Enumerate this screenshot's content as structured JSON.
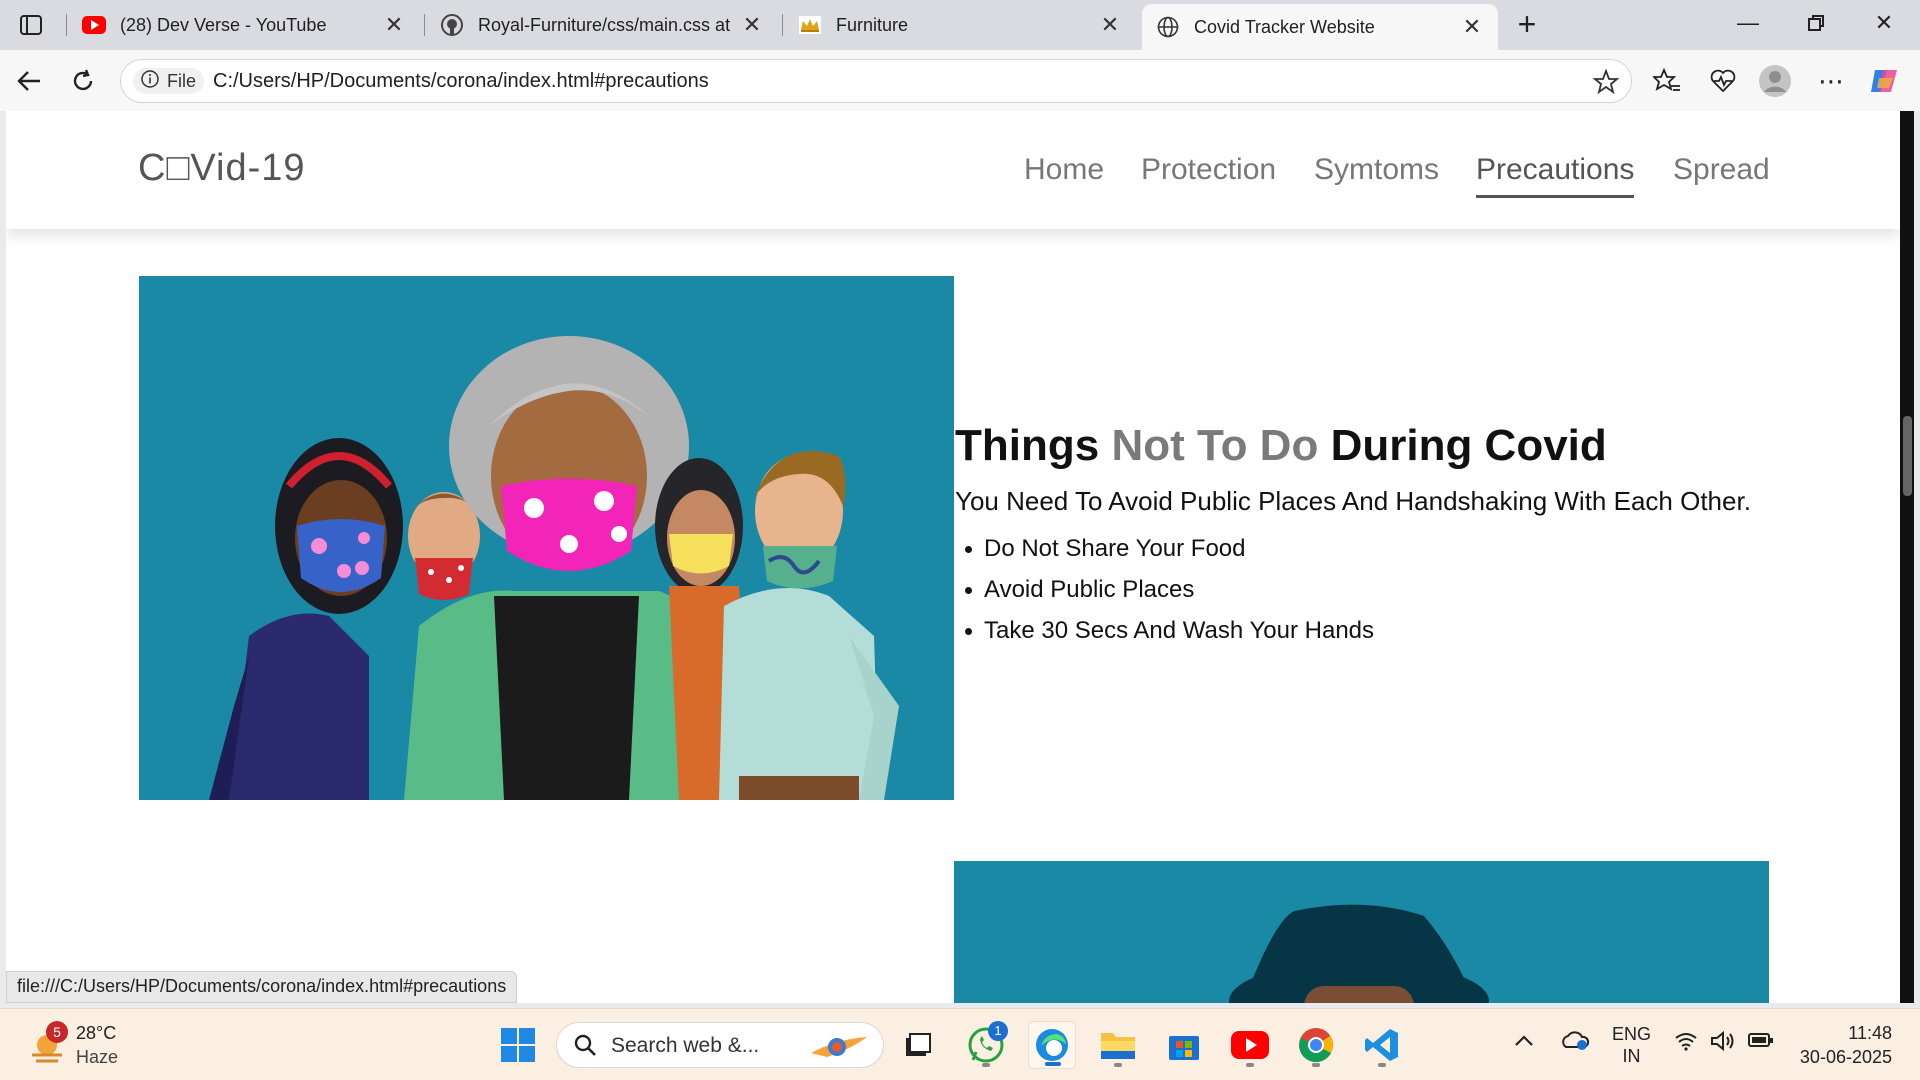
{
  "browser": {
    "tabs": [
      {
        "title": "(28) Dev Verse - YouTube",
        "icon": "youtube-icon"
      },
      {
        "title": "Royal-Furniture/css/main.css at m",
        "icon": "github-icon"
      },
      {
        "title": "Furniture",
        "icon": "crown-icon"
      },
      {
        "title": "Covid Tracker Website",
        "icon": "globe-icon",
        "active": true
      }
    ],
    "address": {
      "scheme_label": "File",
      "url": "C:/Users/HP/Documents/corona/index.html#precautions"
    },
    "status_url": "file:///C:/Users/HP/Documents/corona/index.html#precautions"
  },
  "site": {
    "logo": "C□Vid-19",
    "nav": [
      "Home",
      "Protection",
      "Symtoms",
      "Precautions",
      "Spread"
    ],
    "active_nav": "Precautions",
    "section": {
      "heading_start": "Things ",
      "heading_highlight": "Not To Do",
      "heading_end": " During Covid",
      "subtext": "You Need To Avoid Public Places And Handshaking With Each Other.",
      "bullets": [
        "Do Not Share Your Food",
        "Avoid Public Places",
        "Take 30 Secs And Wash Your Hands"
      ]
    },
    "colors": {
      "image_bg": "#1a89a6",
      "highlight": "#7a7a7a"
    }
  },
  "taskbar": {
    "weather": {
      "temp": "28°C",
      "condition": "Haze",
      "badge": "5"
    },
    "search_placeholder": "Search web &...",
    "whatsapp_badge": "1",
    "language": {
      "line1": "ENG",
      "line2": "IN"
    },
    "time": "11:48",
    "date": "30-06-2025"
  }
}
